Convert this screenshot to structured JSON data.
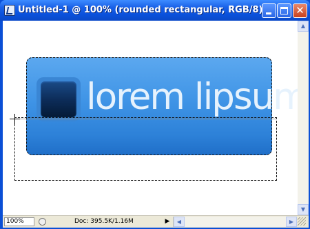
{
  "window": {
    "title": "Untitled-1 @ 100% (rounded rectangular, RGB/8)",
    "controls": {
      "minimize_icon": "minimize-icon",
      "maximize_icon": "maximize-icon",
      "close_icon": "close-icon",
      "close_glyph": "✕"
    }
  },
  "canvas": {
    "graphic_text": "lorem lipsum",
    "colors": {
      "button_top": "#5ca8ef",
      "button_bottom": "#1f6ec8",
      "square_dark": "#0d2d5a",
      "text": "#e6f2fd"
    }
  },
  "statusbar": {
    "zoom": "100%",
    "doc_info": "Doc: 395.5K/1.16M",
    "menu_arrow": "▶"
  },
  "scrollbars": {
    "up_glyph": "▲",
    "down_glyph": "▼",
    "left_glyph": "◀",
    "right_glyph": "▶"
  }
}
